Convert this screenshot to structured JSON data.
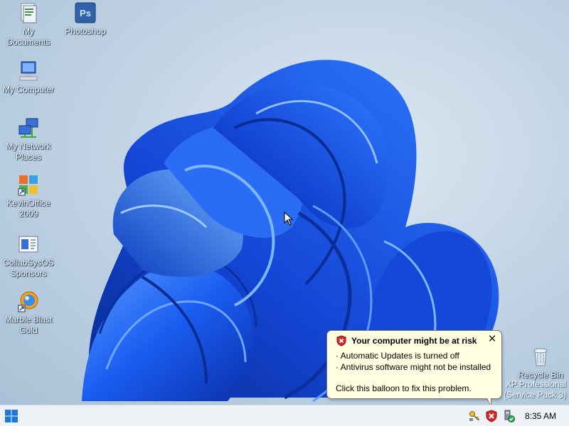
{
  "desktop": {
    "icons": [
      {
        "label": "My\nDocuments",
        "icon": "my-documents-icon"
      },
      {
        "label": "Photoshop",
        "icon": "photoshop-icon",
        "glyph": "Ps"
      },
      {
        "label": "My Computer",
        "icon": "my-computer-icon"
      },
      {
        "label": "My Network\nPlaces",
        "icon": "network-places-icon"
      },
      {
        "label": "KevinOffice\n2009",
        "icon": "office-suite-icon"
      },
      {
        "label": "CollabSysOS\nSponsors",
        "icon": "sponsors-icon"
      },
      {
        "label": "Marble Blast\nGold",
        "icon": "marble-blast-icon"
      },
      {
        "label": "Recycle Bin",
        "icon": "recycle-bin-icon"
      }
    ],
    "watermark": {
      "line1": "XP Professional",
      "line2": "(Service Pack 3)"
    }
  },
  "balloon": {
    "title": "Your computer might be at risk",
    "line1": "· Automatic Updates is turned off",
    "line2": "· Antivirus software might not be installed",
    "action": "Click this balloon to fix this problem.",
    "close_glyph": "✕"
  },
  "taskbar": {
    "start_icon": "windows-start-icon",
    "tray": [
      "network-key-icon",
      "security-shield-icon",
      "safely-remove-hardware-icon"
    ],
    "clock": "8:35 AM"
  },
  "colors": {
    "bloom_blue": "#1a5cf0",
    "balloon_bg": "#ffffe1",
    "shield_red": "#d62b2b",
    "start_blue": "#1e78d8"
  }
}
